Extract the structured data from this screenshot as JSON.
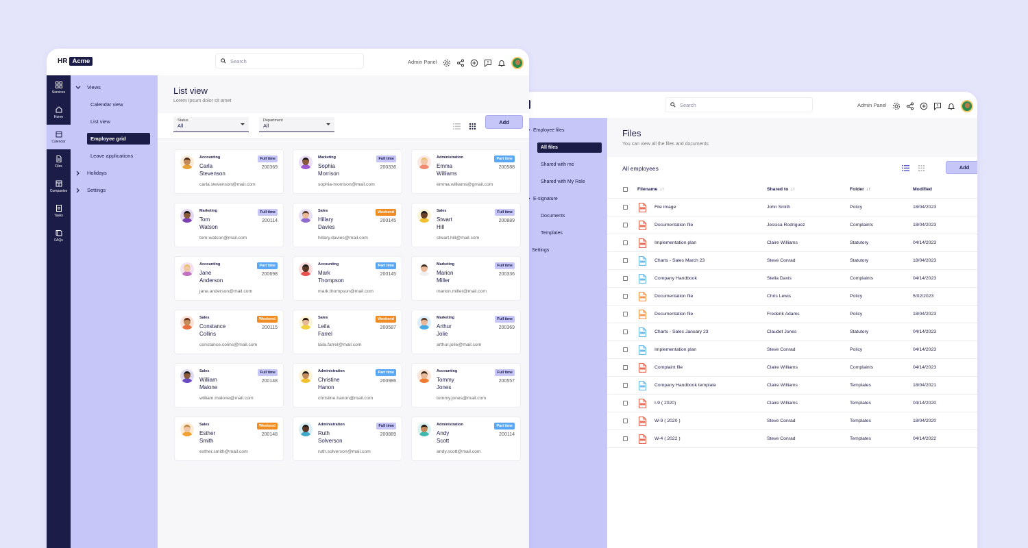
{
  "colors": {
    "navy": "#1c1c48",
    "lavender": "#c6c6f8",
    "full_time": "#c6c6f8",
    "part_time": "#5aa8f5",
    "weekend": "#f08c22",
    "pdf_red": "#e5533e",
    "doc_blue": "#5ab0e6",
    "doc_orange": "#f0883a"
  },
  "w1": {
    "logo": {
      "hr": "HR",
      "acme": "Acme"
    },
    "search_placeholder": "Search",
    "admin_label": "Admin Panel",
    "rail": [
      {
        "label": "Services",
        "icon": "grid-icon"
      },
      {
        "label": "Home",
        "icon": "home-icon"
      },
      {
        "label": "Calendar",
        "icon": "calendar-icon"
      },
      {
        "label": "Files",
        "icon": "file-icon"
      },
      {
        "label": "Companies",
        "icon": "building-icon"
      },
      {
        "label": "Tasks",
        "icon": "tasks-icon"
      },
      {
        "label": "FAQs",
        "icon": "book-icon"
      }
    ],
    "nav": {
      "views": "Views",
      "calendar_view": "Calendar view",
      "list_view": "List view",
      "employee_grid": "Employee grid",
      "leave_applications": "Leave applications",
      "holidays": "Holidays",
      "settings": "Settings"
    },
    "title": "List view",
    "subtitle": "Lorem ipsum dolor sit amet",
    "filters": {
      "status_label": "Status",
      "status_value": "All",
      "department_label": "Department",
      "department_value": "All"
    },
    "add_label": "Add",
    "cards": [
      {
        "dept": "Accounting",
        "first": "Carla",
        "last": "Stevenson",
        "badge": "Full time",
        "id": "200369",
        "email": "carla.stevenson@mail.com",
        "skin": "#c58a5a",
        "shirt": "#e8a23a",
        "hair": "#4a2a18"
      },
      {
        "dept": "Marketing",
        "first": "Sophia",
        "last": "Morrison",
        "badge": "Full time",
        "id": "200336",
        "email": "sophia-morrison@mail.com",
        "skin": "#8a5a3a",
        "shirt": "#9b59d0",
        "hair": "#1a1a1a"
      },
      {
        "dept": "Administration",
        "first": "Emma",
        "last": "Williams",
        "badge": "Part time",
        "id": "200588",
        "email": "emma.williams@gmail.com",
        "skin": "#f0c8a8",
        "shirt": "#f08a70",
        "hair": "#e8c070"
      },
      {
        "dept": "Marketing",
        "first": "Tom",
        "last": "Watson",
        "badge": "Full time",
        "id": "200114",
        "email": "tom-watson@mail.com",
        "skin": "#8a5a3a",
        "shirt": "#7a3fb0",
        "hair": "#1a1a1a"
      },
      {
        "dept": "Sales",
        "first": "Hillary",
        "last": "Davies",
        "badge": "Weekend",
        "id": "200145",
        "email": "hillary.davies@mail.com",
        "skin": "#e8b898",
        "shirt": "#8e6ad0",
        "hair": "#5a3a2a"
      },
      {
        "dept": "Sales",
        "first": "Stwart",
        "last": "Hill",
        "badge": "Full time",
        "id": "200889",
        "email": "stwart.hill@mail.com",
        "skin": "#6a4028",
        "shirt": "#f0c030",
        "hair": "#1a1a1a"
      },
      {
        "dept": "Accounting",
        "first": "Jane",
        "last": "Anderson",
        "badge": "Part time",
        "id": "200698",
        "email": "jane.anderson@mail.com",
        "skin": "#f0c8a8",
        "shirt": "#c070c0",
        "hair": "#e8c070"
      },
      {
        "dept": "Accounting",
        "first": "Mark",
        "last": "Thompson",
        "badge": "Part time",
        "id": "200145",
        "email": "mark.thompson@mail.com",
        "skin": "#5a3828",
        "shirt": "#e85050",
        "hair": "#1a1a1a"
      },
      {
        "dept": "Marketing",
        "first": "Marion",
        "last": "Miller",
        "badge": "Full time",
        "id": "200336",
        "email": "marion.miller@mail.com",
        "skin": "#e8b898",
        "shirt": "#f0f0f0",
        "hair": "#3a2a1a"
      },
      {
        "dept": "Sales",
        "first": "Constance",
        "last": "Collins",
        "badge": "Weekend",
        "id": "200115",
        "email": "constance.colins@mail.com",
        "skin": "#c58a5a",
        "shirt": "#e87040",
        "hair": "#6a3018"
      },
      {
        "dept": "Sales",
        "first": "Leila",
        "last": "Farrel",
        "badge": "Weekend",
        "id": "200587",
        "email": "laila.farrel@mail.com",
        "skin": "#e8b898",
        "shirt": "#f0d040",
        "hair": "#2a1a10"
      },
      {
        "dept": "Marketing",
        "first": "Arthur",
        "last": "Jolie",
        "badge": "Full time",
        "id": "200369",
        "email": "arthur.jolie@mail.com",
        "skin": "#e8b898",
        "shirt": "#4aa8e0",
        "hair": "#5a3a2a"
      },
      {
        "dept": "Sales",
        "first": "William",
        "last": "Malone",
        "badge": "Full time",
        "id": "200148",
        "email": "william.malone@mail.com",
        "skin": "#8a5a3a",
        "shirt": "#6a4ac0",
        "hair": "#1a1a1a"
      },
      {
        "dept": "Administration",
        "first": "Christine",
        "last": "Hanon",
        "badge": "Part time",
        "id": "200986",
        "email": "christine.hanon@mail.com",
        "skin": "#c58a5a",
        "shirt": "#f0c030",
        "hair": "#1a1a1a"
      },
      {
        "dept": "Accounting",
        "first": "Tommy",
        "last": "Jones",
        "badge": "Full time",
        "id": "200557",
        "email": "tommy.jones@mail.com",
        "skin": "#e8b898",
        "shirt": "#f07a30",
        "hair": "#3a2a1a"
      },
      {
        "dept": "Sales",
        "first": "Esther",
        "last": "Smith",
        "badge": "Weekend",
        "id": "200148",
        "email": "esther.smith@mail.com",
        "skin": "#f0c8a8",
        "shirt": "#f0a030",
        "hair": "#c08a40"
      },
      {
        "dept": "Administration",
        "first": "Ruth",
        "last": "Solverson",
        "badge": "Full time",
        "id": "200889",
        "email": "ruth.solverson@mail.com",
        "skin": "#5a3828",
        "shirt": "#40a8c8",
        "hair": "#1a1a1a"
      },
      {
        "dept": "Administration",
        "first": "Andy",
        "last": "Scott",
        "badge": "Part time",
        "id": "200114",
        "email": "andy.scott@mail.com",
        "skin": "#c58a5a",
        "shirt": "#40b8b0",
        "hair": "#1a1a1a"
      }
    ]
  },
  "w2": {
    "logo_partial": "me",
    "search_placeholder": "Search",
    "admin_label": "Admin Panel",
    "nav": {
      "employee_files": "Employee files",
      "all_files": "All files",
      "shared_with_me": "Shared with me",
      "shared_with_my_role": "Shared with My Role",
      "e_signature": "E-signature",
      "documents": "Documents",
      "templates": "Templates",
      "settings": "Settings"
    },
    "title": "Files",
    "subtitle": "You can view all the  files and documents",
    "all_employees": "All employees",
    "add_label": "Add",
    "columns": {
      "filename": "Filename",
      "shared_to": "Shared to",
      "folder": "Folder",
      "modified": "Modified",
      "sort_arrows": "↓↑"
    },
    "rows": [
      {
        "filename": "File image",
        "shared_to": "John Smith",
        "folder": "Policy",
        "modified": "18/04/2023",
        "icon": "pdf"
      },
      {
        "filename": "Documentation file",
        "shared_to": "Jessica Rodriguez",
        "folder": "Complaints",
        "modified": "18/04/2023",
        "icon": "pdf"
      },
      {
        "filename": "Implementation plan",
        "shared_to": "Claire Williams",
        "folder": "Statutory",
        "modified": "04/14/2023",
        "icon": "pdf"
      },
      {
        "filename": "Charts - Sales March 23",
        "shared_to": "Steve Conrad",
        "folder": "Statutory",
        "modified": "18/04/2023",
        "icon": "doc-blue"
      },
      {
        "filename": "Company Handbook",
        "shared_to": "Stella Davis",
        "folder": "Complaints",
        "modified": "04/14/2023",
        "icon": "doc-blue"
      },
      {
        "filename": "Documentation file",
        "shared_to": "Chris Lewis",
        "folder": "Policy",
        "modified": "5/02/2023",
        "icon": "doc-orange"
      },
      {
        "filename": "Documentation file",
        "shared_to": "Frederik Adams",
        "folder": "Policy",
        "modified": "18/04/2023",
        "icon": "doc-orange"
      },
      {
        "filename": "Charts - Sales January 23",
        "shared_to": "Claudet Jones",
        "folder": "Statutory",
        "modified": "04/14/2023",
        "icon": "doc-blue"
      },
      {
        "filename": "Implementation plan",
        "shared_to": "Steve Conrad",
        "folder": "Policy",
        "modified": "04/14/2023",
        "icon": "doc-blue"
      },
      {
        "filename": "Complaint file",
        "shared_to": "Claire Williams",
        "folder": "Complaints",
        "modified": "04/14/2023",
        "icon": "pdf"
      },
      {
        "filename": "Company Handbook template",
        "shared_to": "Claire Williams",
        "folder": "Templates",
        "modified": "18/04/2021",
        "icon": "doc-blue"
      },
      {
        "filename": "I-9 ( 2020)",
        "shared_to": "Claire Williams",
        "folder": "Templates",
        "modified": "04/14/2020",
        "icon": "pdf"
      },
      {
        "filename": "W-9 ( 2020 )",
        "shared_to": "Steve Conrad",
        "folder": "Templates",
        "modified": "18/04/2020",
        "icon": "pdf"
      },
      {
        "filename": "W-4 ( 2022 )",
        "shared_to": "Steve Conrad",
        "folder": "Templates",
        "modified": "04/14/2022",
        "icon": "pdf"
      }
    ]
  }
}
